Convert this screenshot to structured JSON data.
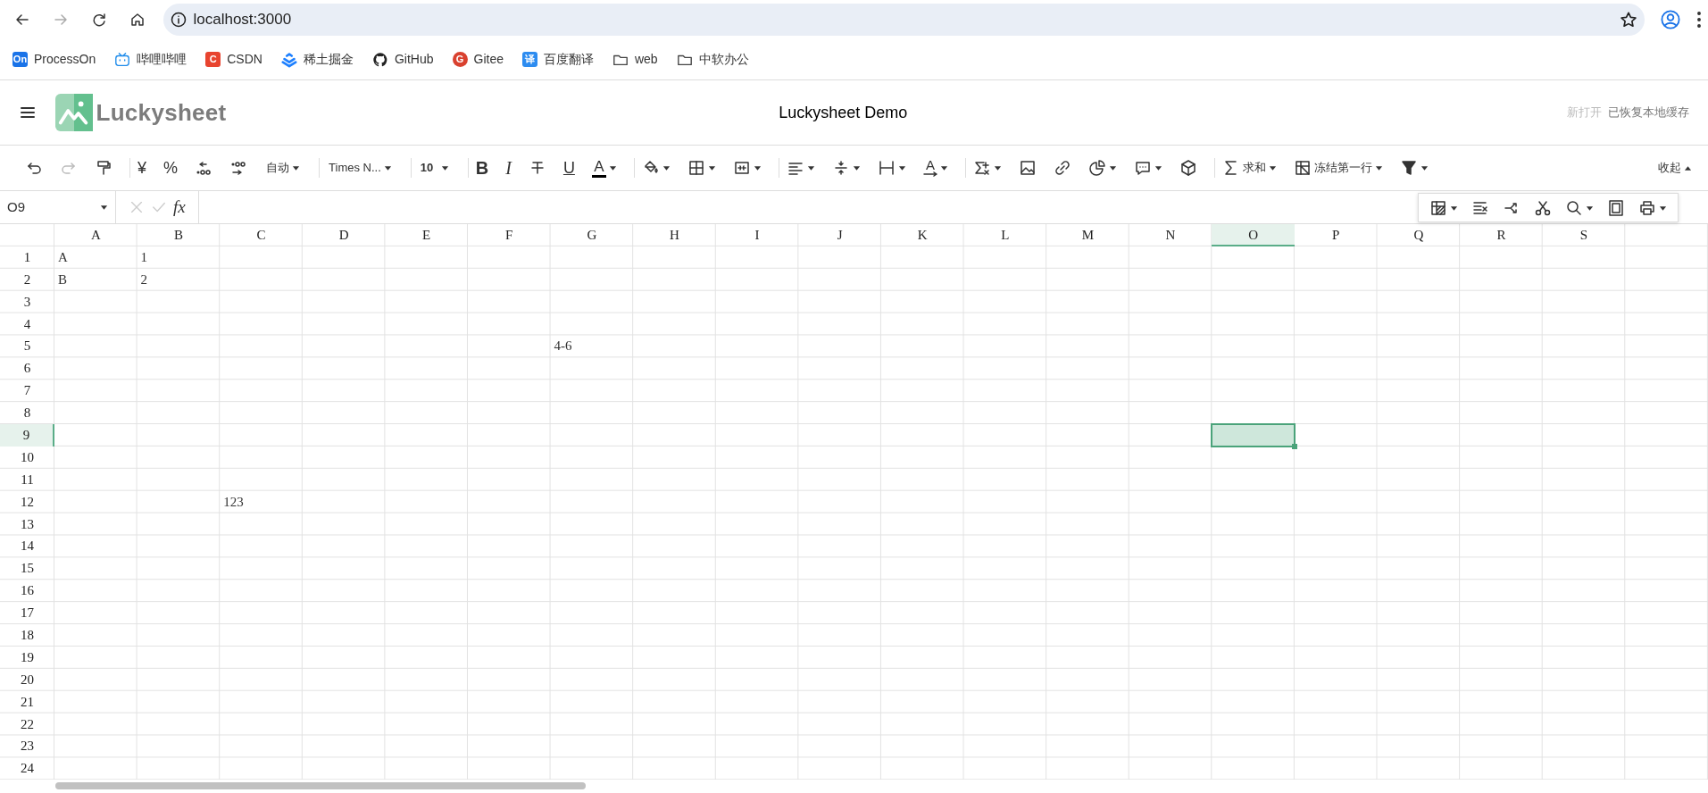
{
  "browser": {
    "address": "localhost:3000",
    "nav": [
      {
        "kind": "back",
        "disabled": false
      },
      {
        "kind": "forward",
        "disabled": true
      },
      {
        "kind": "reload",
        "disabled": false
      },
      {
        "kind": "home",
        "disabled": false
      }
    ],
    "bookmarks": [
      {
        "label": "ProcessOn",
        "kind": "badge",
        "badge": "On",
        "color": "#1a73e8"
      },
      {
        "label": "哔哩哔哩",
        "kind": "tv",
        "color": "#1f8ceb"
      },
      {
        "label": "CSDN",
        "kind": "badge",
        "badge": "C",
        "color": "#e8442f"
      },
      {
        "label": "稀土掘金",
        "kind": "chevrons",
        "color": "#1e80ff"
      },
      {
        "label": "GitHub",
        "kind": "octocat",
        "color": "#222222"
      },
      {
        "label": "Gitee",
        "kind": "round-badge",
        "badge": "G",
        "color": "#d9412f"
      },
      {
        "label": "百度翻译",
        "kind": "badge",
        "badge": "译",
        "color": "#2d8cf0"
      },
      {
        "label": "web",
        "kind": "folder",
        "color": "#444444"
      },
      {
        "label": "中软办公",
        "kind": "folder",
        "color": "#444444"
      }
    ]
  },
  "app": {
    "logo": "Luckysheet",
    "title": "Luckysheet Demo",
    "status_muted": "新打开",
    "status": "已恢复本地缓存"
  },
  "toolbar": [
    {
      "kind": "undo",
      "caret": false
    },
    {
      "kind": "redo",
      "caret": false,
      "disabled": true
    },
    {
      "kind": "painter",
      "caret": false
    },
    {
      "kind": "sep"
    },
    {
      "kind": "text",
      "label": "¥",
      "caret": false
    },
    {
      "kind": "text",
      "label": "%",
      "caret": false
    },
    {
      "kind": "decimal-less",
      "caret": false
    },
    {
      "kind": "decimal-more",
      "caret": false
    },
    {
      "kind": "select",
      "label": "自动",
      "caret": true
    },
    {
      "kind": "sep"
    },
    {
      "kind": "select",
      "label": "Times N...",
      "caret": true
    },
    {
      "kind": "sep"
    },
    {
      "kind": "select",
      "label": "10",
      "caret": true
    },
    {
      "kind": "sep"
    },
    {
      "kind": "bold",
      "label": "B",
      "caret": false
    },
    {
      "kind": "italic",
      "label": "I",
      "caret": false
    },
    {
      "kind": "strike",
      "caret": false
    },
    {
      "kind": "underline",
      "label": "U",
      "caret": false
    },
    {
      "kind": "text-color",
      "label": "A",
      "color": "#000000",
      "caret": true
    },
    {
      "kind": "sep"
    },
    {
      "kind": "fill",
      "caret": true
    },
    {
      "kind": "border",
      "caret": true
    },
    {
      "kind": "merge",
      "caret": true
    },
    {
      "kind": "sep"
    },
    {
      "kind": "align",
      "caret": true
    },
    {
      "kind": "valign",
      "caret": true
    },
    {
      "kind": "wrap",
      "caret": true
    },
    {
      "kind": "rotate",
      "label": "A",
      "caret": true
    },
    {
      "kind": "sep"
    },
    {
      "kind": "function",
      "caret": true
    },
    {
      "kind": "image",
      "caret": false
    },
    {
      "kind": "link",
      "caret": false
    },
    {
      "kind": "chart",
      "caret": true
    },
    {
      "kind": "comment",
      "caret": true
    },
    {
      "kind": "cube",
      "caret": false
    },
    {
      "kind": "sep"
    },
    {
      "kind": "sum",
      "label": "求和",
      "caret": true
    },
    {
      "kind": "freeze",
      "label": "冻结第一行",
      "caret": true
    },
    {
      "kind": "filter",
      "caret": true
    }
  ],
  "collapse": {
    "label": "收起"
  },
  "floating_toolbar": [
    {
      "kind": "cond-format",
      "caret": true
    },
    {
      "kind": "clear",
      "caret": false
    },
    {
      "kind": "split",
      "caret": false
    },
    {
      "kind": "cut",
      "caret": false
    },
    {
      "kind": "search",
      "caret": true
    },
    {
      "kind": "screenshot",
      "caret": false
    },
    {
      "kind": "print",
      "caret": true
    }
  ],
  "formula_bar": {
    "name_box": "O9",
    "fx": "fx"
  },
  "sheet": {
    "columns": [
      {
        "label": "A",
        "selected": false
      },
      {
        "label": "B",
        "selected": false
      },
      {
        "label": "C",
        "selected": false
      },
      {
        "label": "D",
        "selected": false
      },
      {
        "label": "E",
        "selected": false
      },
      {
        "label": "F",
        "selected": false
      },
      {
        "label": "G",
        "selected": false
      },
      {
        "label": "H",
        "selected": false
      },
      {
        "label": "I",
        "selected": false
      },
      {
        "label": "J",
        "selected": false
      },
      {
        "label": "K",
        "selected": false
      },
      {
        "label": "L",
        "selected": false
      },
      {
        "label": "M",
        "selected": false
      },
      {
        "label": "N",
        "selected": false
      },
      {
        "label": "O",
        "selected": true
      },
      {
        "label": "P",
        "selected": false
      },
      {
        "label": "Q",
        "selected": false
      },
      {
        "label": "R",
        "selected": false
      },
      {
        "label": "S",
        "selected": false
      }
    ],
    "rows": [
      {
        "label": "1",
        "selected": false,
        "cells": [
          {
            "text": "A"
          },
          {
            "text": "1"
          }
        ]
      },
      {
        "label": "2",
        "selected": false,
        "cells": [
          {
            "text": "B"
          },
          {
            "text": "2"
          }
        ]
      },
      {
        "label": "3",
        "selected": false
      },
      {
        "label": "4",
        "selected": false
      },
      {
        "label": "5",
        "selected": false,
        "cells": [
          {},
          {},
          {},
          {},
          {},
          {},
          {
            "text": "4-6"
          }
        ]
      },
      {
        "label": "6",
        "selected": false
      },
      {
        "label": "7",
        "selected": false
      },
      {
        "label": "8",
        "selected": false
      },
      {
        "label": "9",
        "selected": true
      },
      {
        "label": "10",
        "selected": false
      },
      {
        "label": "11",
        "selected": false
      },
      {
        "label": "12",
        "selected": false,
        "cells": [
          {},
          {},
          {
            "text": "123"
          }
        ]
      },
      {
        "label": "13",
        "selected": false
      },
      {
        "label": "14",
        "selected": false
      },
      {
        "label": "15",
        "selected": false
      },
      {
        "label": "16",
        "selected": false
      },
      {
        "label": "17",
        "selected": false
      },
      {
        "label": "18",
        "selected": false
      },
      {
        "label": "19",
        "selected": false
      },
      {
        "label": "20",
        "selected": false
      },
      {
        "label": "21",
        "selected": false
      },
      {
        "label": "22",
        "selected": false
      },
      {
        "label": "23",
        "selected": false
      },
      {
        "label": "24",
        "selected": false
      }
    ]
  }
}
